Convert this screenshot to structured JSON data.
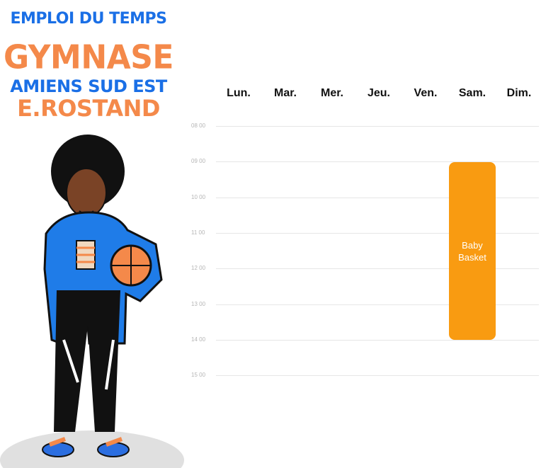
{
  "header": {
    "line1": "EMPLOI DU TEMPS",
    "line2": "GYMNASE",
    "line3": "AMIENS SUD EST",
    "line4": "E.ROSTAND"
  },
  "days": [
    "Lun.",
    "Mar.",
    "Mer.",
    "Jeu.",
    "Ven.",
    "Sam.",
    "Dim."
  ],
  "hours": [
    "08 00",
    "09 00",
    "10 00",
    "11 00",
    "12 00",
    "13 00",
    "14 00",
    "15 00"
  ],
  "events": [
    {
      "title": "Baby Basket",
      "day": "Sam.",
      "start": "09 00",
      "end": "14 00",
      "color": "#f99b11"
    }
  ],
  "colors": {
    "blue": "#1a6fe6",
    "orange": "#f4894a"
  }
}
